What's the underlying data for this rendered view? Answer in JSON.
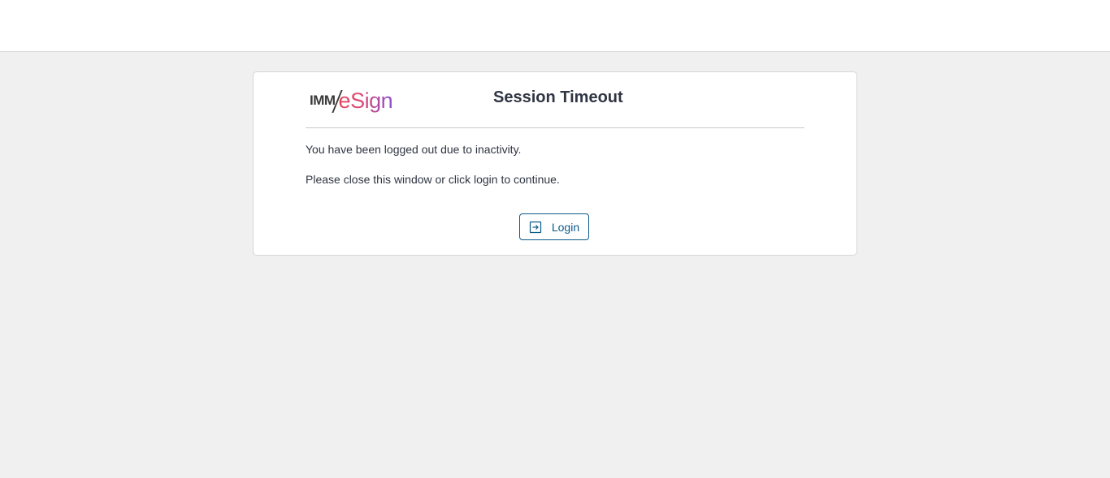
{
  "logo": {
    "prefix": "IMM",
    "brand": "eSign"
  },
  "dialog": {
    "title": "Session Timeout",
    "message_1": "You have been logged out due to inactivity.",
    "message_2": "Please close this window or click login to continue.",
    "login_label": "Login",
    "login_icon": "login-arrow-icon"
  },
  "colors": {
    "accent": "#0b5a8a",
    "background": "#f0f0f0",
    "logo_gradient_start": "#e8455c",
    "logo_gradient_end": "#8a4fc9"
  }
}
